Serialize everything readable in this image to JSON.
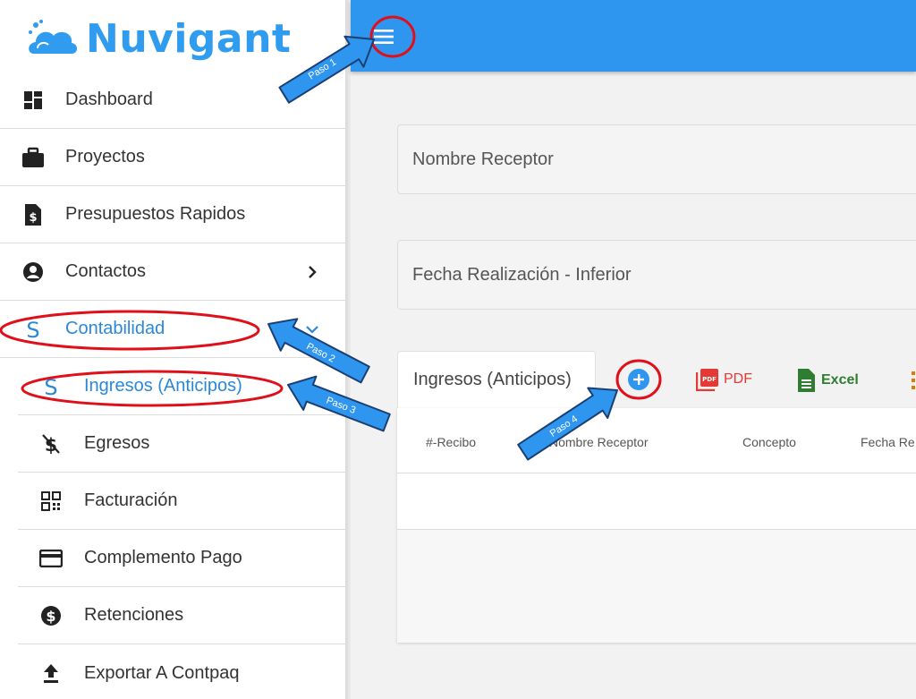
{
  "brand": {
    "name": "Nuvigant"
  },
  "sidebar": {
    "items": [
      {
        "label": "Dashboard",
        "icon": "dashboard-icon"
      },
      {
        "label": "Proyectos",
        "icon": "briefcase-icon"
      },
      {
        "label": "Presupuestos Rapidos",
        "icon": "file-dollar-icon"
      },
      {
        "label": "Contactos",
        "icon": "account-circle-icon",
        "chevron": "chevron-right-icon"
      },
      {
        "label": "Contabilidad",
        "icon": "dollar-icon",
        "chevron": "chevron-down-icon",
        "active": true
      },
      {
        "label": "Ingresos (Anticipos)",
        "icon": "dollar-icon",
        "active": true
      },
      {
        "label": "Egresos",
        "icon": "dollar-off-icon"
      },
      {
        "label": "Facturación",
        "icon": "qr-code-icon"
      },
      {
        "label": "Complemento Pago",
        "icon": "credit-card-icon"
      },
      {
        "label": "Retenciones",
        "icon": "dollar-circle-icon"
      },
      {
        "label": "Exportar A Contpaq",
        "icon": "upload-icon"
      }
    ]
  },
  "filters": {
    "receptor_label": "Nombre Receptor",
    "fecha_label": "Fecha Realización - Inferior"
  },
  "tab": {
    "label": "Ingresos (Anticipos)"
  },
  "toolbar": {
    "pdf_label": "PDF",
    "excel_label": "Excel"
  },
  "table": {
    "headers": [
      "#-Recibo",
      "Nombre Receptor",
      "Concepto",
      "Fecha Re"
    ]
  },
  "annotations": [
    "Paso 1",
    "Paso 2",
    "Paso 3",
    "Paso 4"
  ],
  "colors": {
    "primary": "#2f96f0",
    "accent_text": "#2b88d8",
    "annotation_red": "#e0101a",
    "pdf": "#e53935",
    "excel": "#2e7d32"
  }
}
